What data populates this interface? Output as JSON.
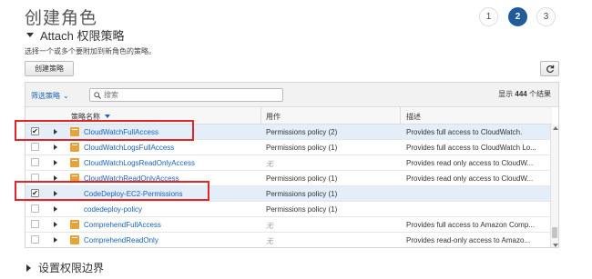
{
  "page": {
    "title": "创建角色"
  },
  "steps": [
    {
      "label": "1",
      "active": false
    },
    {
      "label": "2",
      "active": true
    },
    {
      "label": "3",
      "active": false
    }
  ],
  "section": {
    "title": "Attach 权限策略",
    "description": "选择一个或多个要附加到新角色的策略。"
  },
  "toolbar": {
    "create_label": "创建策略",
    "refresh_icon": "refresh-icon",
    "filter_label": "筛选策略",
    "filter_caret": "⌄",
    "search_placeholder": "搜索",
    "count_prefix": "显示",
    "count_value": "444",
    "count_suffix": "个结果"
  },
  "table": {
    "columns": {
      "name": "策略名称",
      "usage": "用作",
      "description": "描述"
    },
    "rows": [
      {
        "checked": true,
        "icon": true,
        "name": "CloudWatchFullAccess",
        "usage": "Permissions policy (2)",
        "description": "Provides full access to CloudWatch."
      },
      {
        "checked": false,
        "icon": true,
        "name": "CloudWatchLogsFullAccess",
        "usage": "Permissions policy (1)",
        "description": "Provides full access to CloudWatch Lo..."
      },
      {
        "checked": false,
        "icon": true,
        "name": "CloudWatchLogsReadOnlyAccess",
        "usage": "无",
        "description": "Provides read only access to CloudW..."
      },
      {
        "checked": false,
        "icon": true,
        "name": "CloudWatchReadOnlyAccess",
        "usage": "Permissions policy (1)",
        "description": "Provides read only access to CloudW..."
      },
      {
        "checked": true,
        "icon": false,
        "name": "CodeDeploy-EC2-Permissions",
        "usage": "Permissions policy (1)",
        "description": ""
      },
      {
        "checked": false,
        "icon": false,
        "name": "codedeploy-policy",
        "usage": "Permissions policy (1)",
        "description": ""
      },
      {
        "checked": false,
        "icon": true,
        "name": "ComprehendFullAccess",
        "usage": "无",
        "description": "Provides full access to Amazon Comp..."
      },
      {
        "checked": false,
        "icon": true,
        "name": "ComprehendReadOnly",
        "usage": "无",
        "description": "Provides read-only access to Amazo..."
      }
    ]
  },
  "boundary": {
    "title": "设置权限边界"
  },
  "colors": {
    "accent": "#1f5c99",
    "link": "#1a63b5",
    "highlight": "#e0262a",
    "selected_row": "#e3eef9"
  }
}
